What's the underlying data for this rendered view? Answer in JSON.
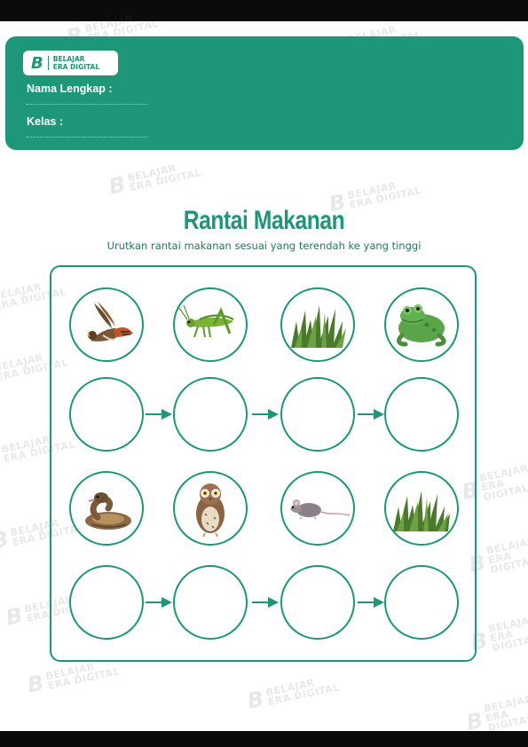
{
  "brand": {
    "name_line1": "BELAJAR",
    "name_line2": "ERA DIGITAL",
    "logo_letter": "B"
  },
  "form": {
    "name_label": "Nama Lengkap :",
    "class_label": "Kelas :"
  },
  "worksheet": {
    "title": "Rantai Makanan",
    "instruction": "Urutkan rantai makanan sesuai yang terendah ke yang tinggi"
  },
  "rows": [
    {
      "animals": [
        "hawk",
        "grasshopper",
        "grass",
        "frog"
      ]
    },
    {
      "answer_slots": 4
    },
    {
      "animals": [
        "snake",
        "owl",
        "mouse",
        "grass"
      ]
    },
    {
      "answer_slots": 4
    }
  ],
  "colors": {
    "accent": "#1d967a",
    "page": "#ffffff"
  }
}
